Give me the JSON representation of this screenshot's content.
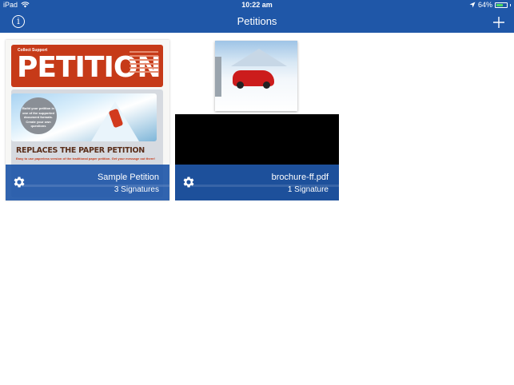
{
  "status_bar": {
    "device": "iPad",
    "time": "10:22 am",
    "battery": "64%",
    "battery_level": 0.64
  },
  "nav": {
    "title": "Petitions"
  },
  "petitions": [
    {
      "name": "Sample Petition",
      "signatures": "3 Signatures",
      "thumbnail": {
        "small_text": "Collect Support",
        "big_text": "PETITION",
        "bubble_text": "Build your petition in one of the supported document formats. Create your own questions",
        "heading": "REPLACES THE PAPER PETITION",
        "subtext": "Easy to use paperless version of the traditional paper petition.  Get your message out there!"
      }
    },
    {
      "name": "brochure-ff.pdf",
      "signatures": "1 Signature"
    }
  ],
  "colors": {
    "bar_blue": "#1f57a8",
    "battery_green": "#4cd964"
  },
  "icons": {
    "info": "info-icon",
    "add": "plus-icon",
    "settings": "gear-icon",
    "wifi": "wifi-icon",
    "location": "location-arrow-icon"
  }
}
